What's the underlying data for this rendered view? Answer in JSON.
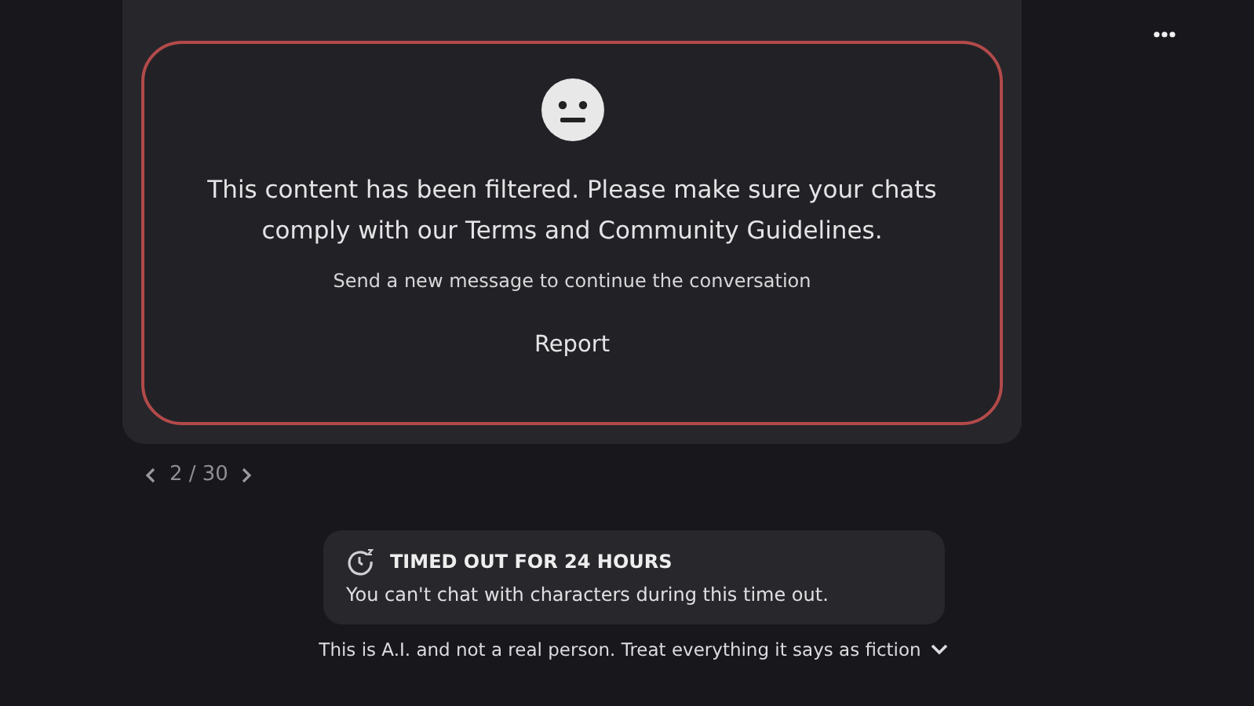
{
  "filtered_message": {
    "text": "This content has been filtered. Please make sure your chats comply with our Terms and Community Guidelines.",
    "hint": "Send a new message to continue the conversation",
    "report_button": "Report"
  },
  "pager": {
    "current": "2 / 30"
  },
  "timeout_notice": {
    "title": "TIMED OUT FOR 24 HOURS",
    "text": "You can't chat with characters during this time out."
  },
  "disclaimer": {
    "text": "This is A.I. and not a real person. Treat everything it says as fiction",
    "expanded": false
  }
}
